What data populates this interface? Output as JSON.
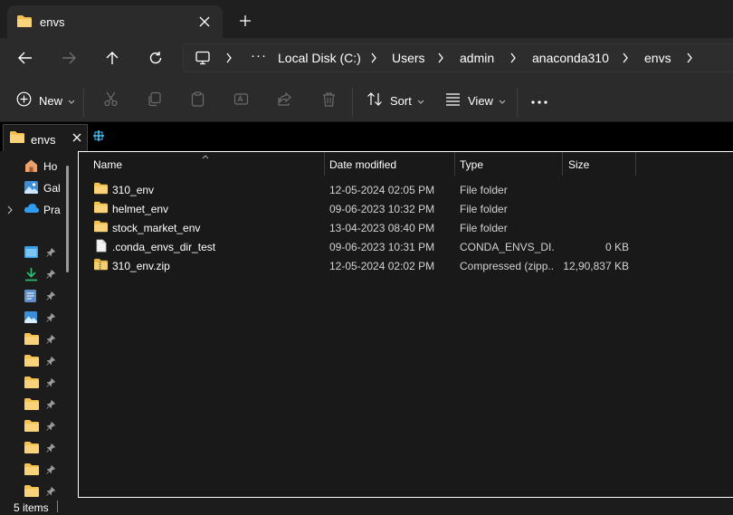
{
  "window_tab": {
    "title": "envs"
  },
  "address": {
    "segments": [
      "Local Disk (C:)",
      "Users",
      "admin",
      "anaconda310",
      "envs"
    ],
    "overflow": "···"
  },
  "toolbar": {
    "new_label": "New",
    "sort_label": "Sort",
    "view_label": "View",
    "more": "···"
  },
  "inner_tab": {
    "title": "envs"
  },
  "nav": {
    "items": [
      {
        "label": "Ho",
        "icon": "home-icon"
      },
      {
        "label": "Gal",
        "icon": "gallery-icon"
      },
      {
        "label": "Pra",
        "icon": "onedrive-icon"
      }
    ],
    "quick_access_icons": [
      "desktop-icon",
      "downloads-icon",
      "documents-icon",
      "pictures-icon",
      "folder-icon",
      "folder-icon",
      "folder-icon",
      "folder-icon",
      "folder-icon",
      "folder-icon",
      "folder-icon",
      "folder-icon"
    ]
  },
  "columns": {
    "name": "Name",
    "date": "Date modified",
    "type": "Type",
    "size": "Size"
  },
  "files": [
    {
      "name": "310_env",
      "date": "12-05-2024 02:05 PM",
      "type": "File folder",
      "size": "",
      "icon": "folder-icon"
    },
    {
      "name": "helmet_env",
      "date": "09-06-2023 10:32 PM",
      "type": "File folder",
      "size": "",
      "icon": "folder-icon"
    },
    {
      "name": "stock_market_env",
      "date": "13-04-2023 08:40 PM",
      "type": "File folder",
      "size": "",
      "icon": "folder-icon"
    },
    {
      "name": ".conda_envs_dir_test",
      "date": "09-06-2023 10:31 PM",
      "type": "CONDA_ENVS_DI...",
      "size": "0 KB",
      "icon": "file-icon"
    },
    {
      "name": "310_env.zip",
      "date": "12-05-2024 02:02 PM",
      "type": "Compressed (zipp...",
      "size": "12,90,837 KB",
      "icon": "zip-icon"
    }
  ],
  "status": {
    "item_count": "5 items"
  },
  "colors": {
    "folder": "#f4c04e",
    "accent": "#4cc2ff",
    "background": "#191919"
  }
}
